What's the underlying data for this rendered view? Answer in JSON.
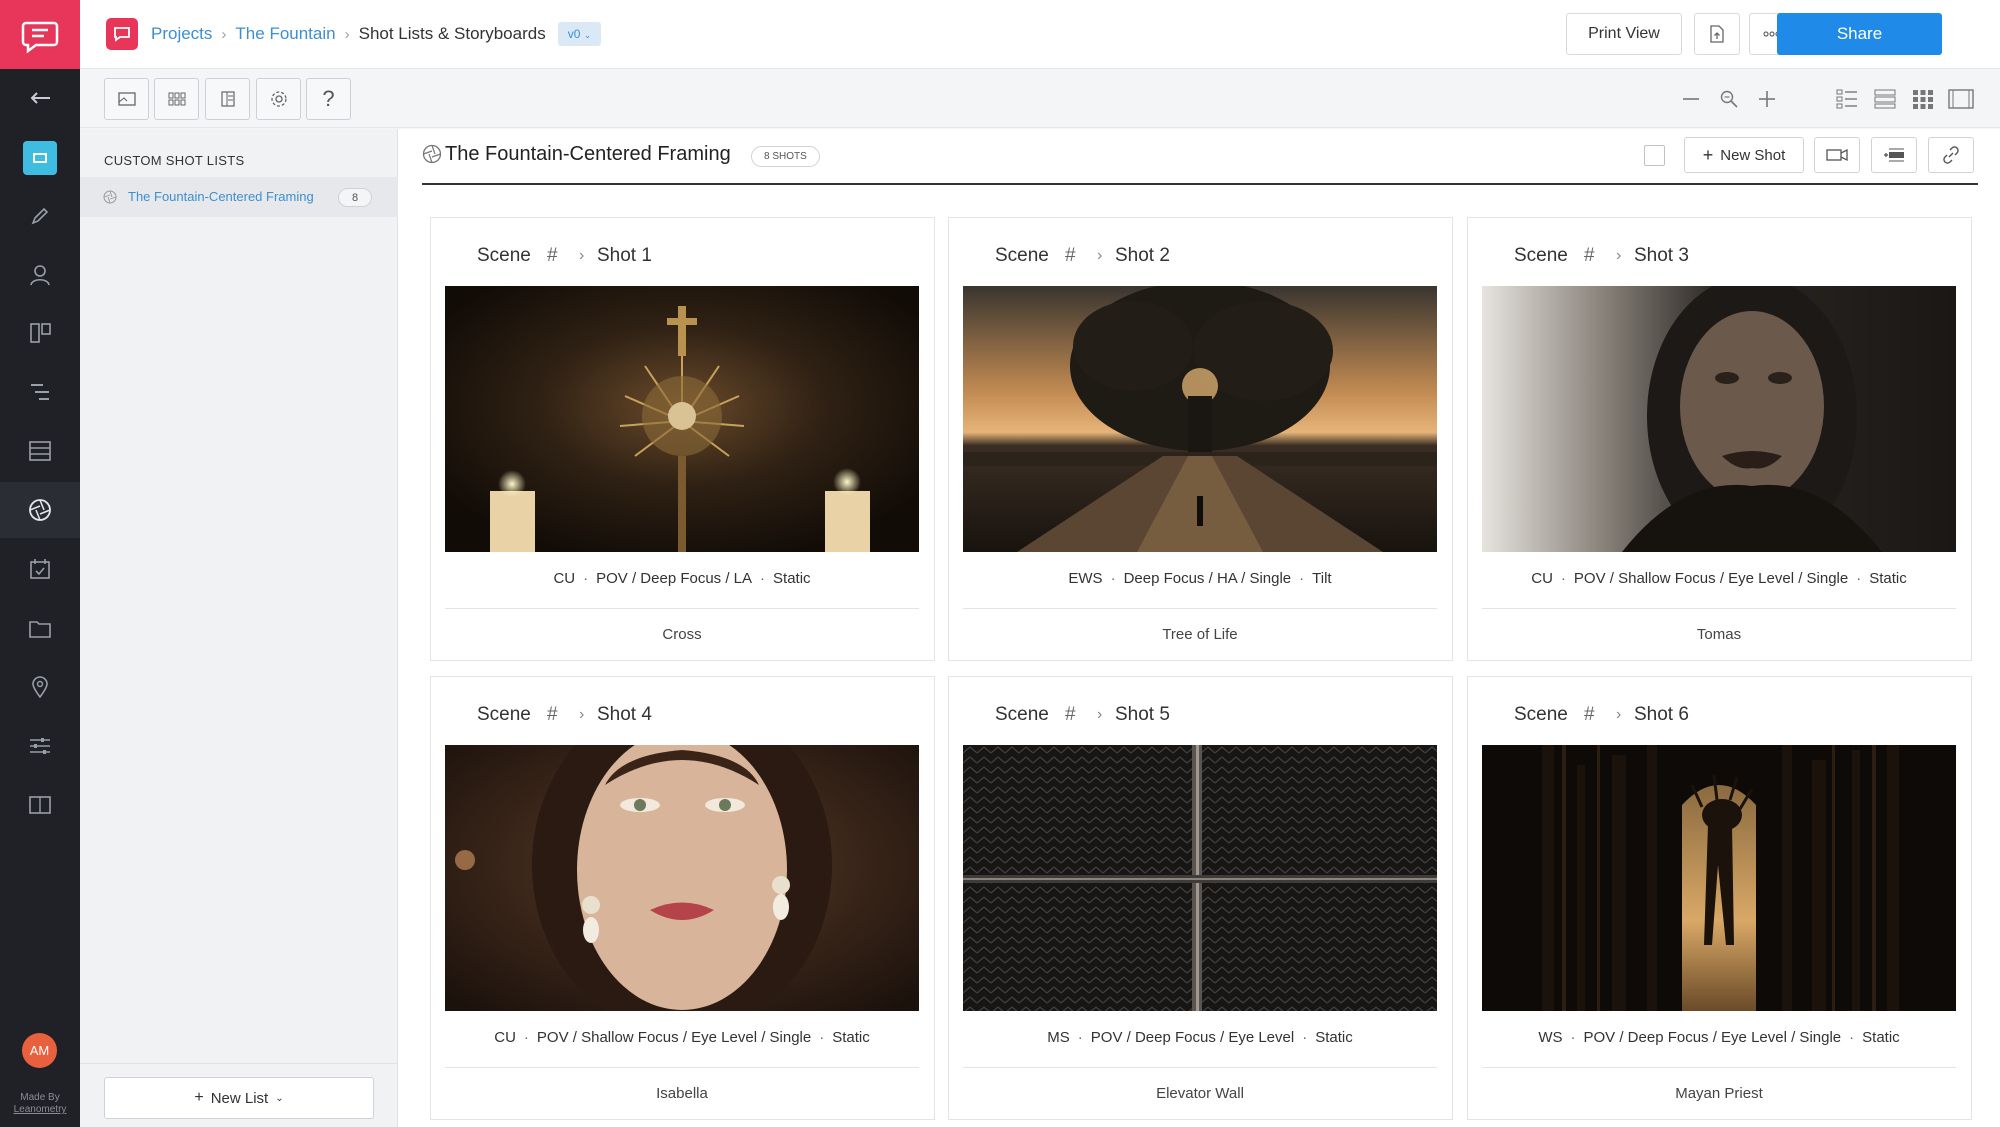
{
  "rail": {
    "made_by_line1": "Made By",
    "made_by_line2": "Leanometry",
    "avatar_initials": "AM",
    "icons": [
      "chat-logo-icon",
      "back-arrow-icon",
      "storyboard-icon",
      "pencil-icon",
      "characters-icon",
      "boards-icon",
      "gantt-icon",
      "list-icon",
      "shotlist-aperture-icon",
      "calendar-icon",
      "folder-icon",
      "location-pin-icon",
      "sliders-icon",
      "book-icon"
    ]
  },
  "header": {
    "breadcrumb": {
      "projects": "Projects",
      "project": "The Fountain",
      "current": "Shot Lists & Storyboards"
    },
    "version": "v0",
    "print_view": "Print View",
    "share": "Share"
  },
  "sidepanel": {
    "heading": "CUSTOM SHOT LISTS",
    "items": [
      {
        "label": "The Fountain-Centered Framing",
        "count": "8"
      }
    ],
    "new_list": "New List"
  },
  "list": {
    "title": "The Fountain-Centered Framing",
    "badge": "8 SHOTS",
    "new_shot": "New Shot"
  },
  "cards": [
    {
      "scene": "Scene",
      "hash": "#",
      "shot": "Shot 1",
      "size": "CU",
      "details": "POV / Deep Focus / LA",
      "movement": "Static",
      "subject": "Cross"
    },
    {
      "scene": "Scene",
      "hash": "#",
      "shot": "Shot 2",
      "size": "EWS",
      "details": "Deep Focus / HA / Single",
      "movement": "Tilt",
      "subject": "Tree of Life"
    },
    {
      "scene": "Scene",
      "hash": "#",
      "shot": "Shot 3",
      "size": "CU",
      "details": "POV / Shallow Focus / Eye Level / Single",
      "movement": "Static",
      "subject": "Tomas"
    },
    {
      "scene": "Scene",
      "hash": "#",
      "shot": "Shot 4",
      "size": "CU",
      "details": "POV / Shallow Focus / Eye Level / Single",
      "movement": "Static",
      "subject": "Isabella"
    },
    {
      "scene": "Scene",
      "hash": "#",
      "shot": "Shot 5",
      "size": "MS",
      "details": "POV / Deep Focus / Eye Level",
      "movement": "Static",
      "subject": "Elevator Wall"
    },
    {
      "scene": "Scene",
      "hash": "#",
      "shot": "Shot 6",
      "size": "WS",
      "details": "POV / Deep Focus / Eye Level / Single",
      "movement": "Static",
      "subject": "Mayan Priest"
    }
  ],
  "colors": {
    "brand": "#e8365a",
    "link": "#3d8fd1",
    "primary_button": "#1f8ae8",
    "rail": "#1f2127"
  }
}
